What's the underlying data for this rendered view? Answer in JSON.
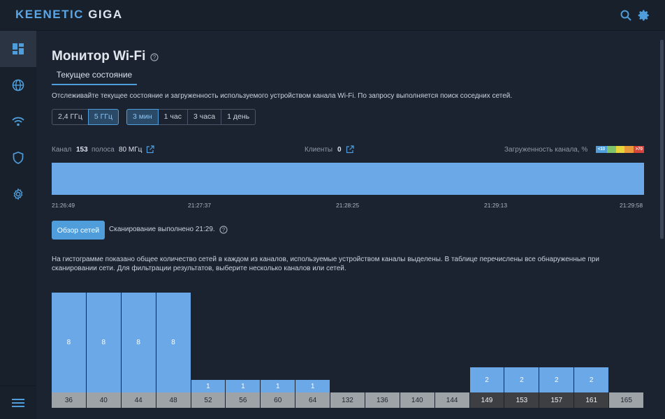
{
  "header": {
    "brand_main": "KEENETIC",
    "brand_sub": "GIGA"
  },
  "page": {
    "title": "Монитор Wi-Fi",
    "tab": "Текущее состояние",
    "description": "Отслеживайте текущее состояние и загруженность используемого устройством канала Wi-Fi. По запросу выполняется поиск соседних сетей."
  },
  "band_buttons": [
    "2,4 ГГц",
    "5 ГГц"
  ],
  "band_selected": "5 ГГц",
  "period_buttons": [
    "3 мин",
    "1 час",
    "3 часа",
    "1 день"
  ],
  "period_selected": "3 мин",
  "stats": {
    "channel_label": "Канал",
    "channel_value": "153",
    "band_label": "полоса",
    "band_value": "80 МГц",
    "clients_label": "Клиенты",
    "clients_value": "0",
    "load_label": "Загруженность канала, %",
    "legend_low": "<10",
    "legend_high": ">70"
  },
  "colors": {
    "accent": "#4f9edb",
    "bar": "#6aa8e8",
    "legend": [
      "#4f9edb",
      "#7fc36a",
      "#e6d43a",
      "#e89a3a",
      "#d9443a"
    ]
  },
  "timeline": [
    "21:26:49",
    "21:27:37",
    "21:28:25",
    "21:29:13",
    "21:29:58"
  ],
  "scan": {
    "button": "Обзор сетей",
    "status": "Сканирование выполнено 21:29."
  },
  "histogram_description": "На гистограмме показано общее количество сетей в каждом из каналов, используемые устройством каналы выделены. В таблице перечислены все обнаруженные при сканировании сети. Для фильтрации результатов, выберите несколько каналов или сетей.",
  "chart_data": {
    "type": "bar",
    "categories": [
      "36",
      "40",
      "44",
      "48",
      "52",
      "56",
      "60",
      "64",
      "132",
      "136",
      "140",
      "144",
      "149",
      "153",
      "157",
      "161",
      "165"
    ],
    "values": [
      8,
      8,
      8,
      8,
      1,
      1,
      1,
      1,
      0,
      0,
      0,
      0,
      2,
      2,
      2,
      2,
      0
    ],
    "highlighted": [
      "149",
      "153",
      "157",
      "161"
    ],
    "title": "",
    "xlabel": "",
    "ylabel": ""
  }
}
